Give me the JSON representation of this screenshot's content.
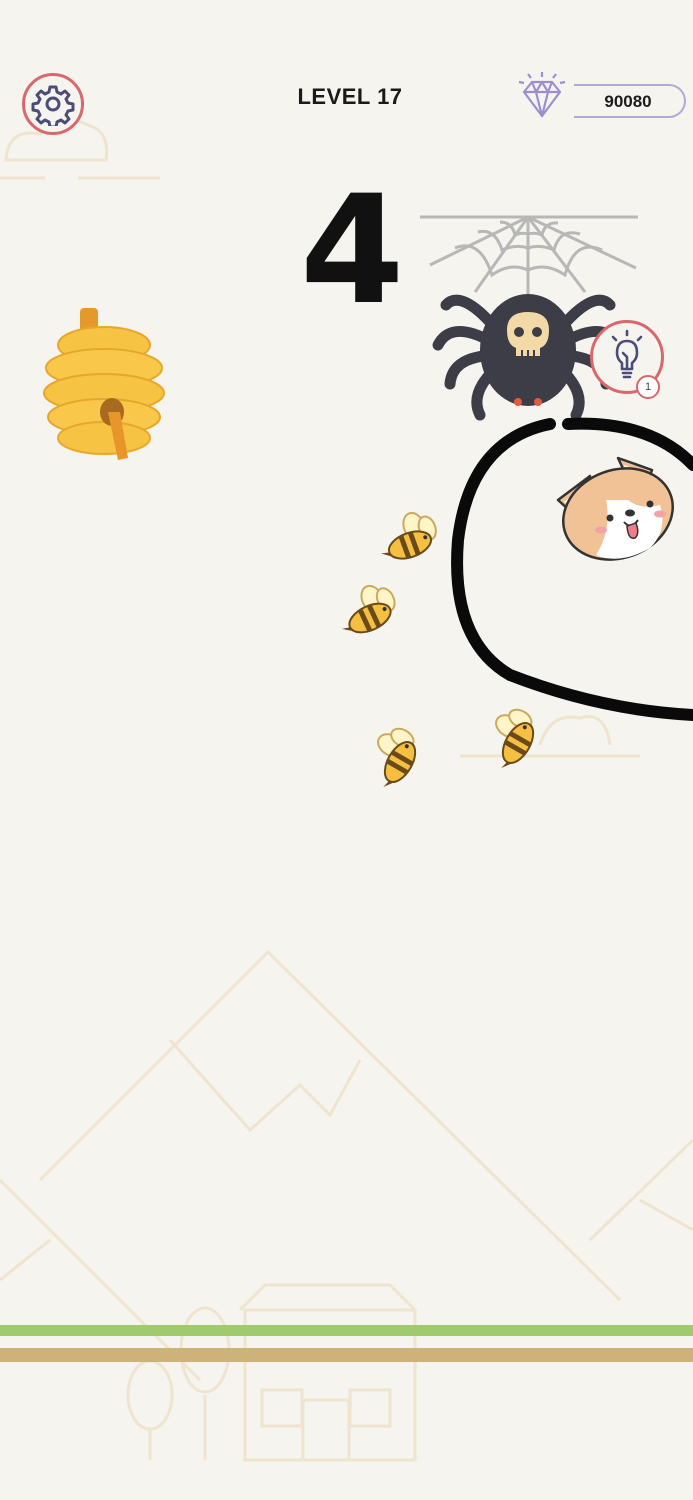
{
  "hud": {
    "level_label": "LEVEL 17",
    "gems": "90080",
    "hint_count": "1"
  },
  "countdown": "4",
  "icons": {
    "settings": "gear-icon",
    "gem": "diamond-icon",
    "hint": "lightbulb-icon"
  },
  "colors": {
    "background": "#f6f4ef",
    "button_ring": "#d8676e",
    "gem_outline": "#9b8fd0",
    "grass": "#9fcb6e",
    "ground": "#cdb27a",
    "drawn_line": "#0a0a0a"
  }
}
